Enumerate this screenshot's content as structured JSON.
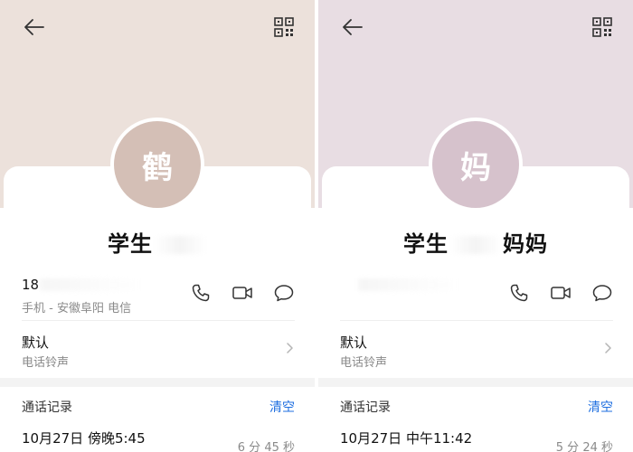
{
  "panels": [
    {
      "hero_color": "#ece1db",
      "avatar_color": "#d4bfb6",
      "avatar_char": "鹤",
      "name_prefix": "学生",
      "name_suffix": "",
      "number": "18",
      "location": "手机 - 安徽阜阳 电信",
      "ringtone_title": "默认",
      "ringtone_sub": "电话铃声",
      "log_title": "通话记录",
      "clear_label": "清空",
      "call_time": "10月27日 傍晚5:45",
      "call_duration": "6 分 45 秒"
    },
    {
      "hero_color": "#e8dde3",
      "avatar_color": "#d6c2cc",
      "avatar_char": "妈",
      "name_prefix": "学生",
      "name_suffix": "妈妈",
      "number": "",
      "location": "",
      "ringtone_title": "默认",
      "ringtone_sub": "电话铃声",
      "log_title": "通话记录",
      "clear_label": "清空",
      "call_time": "10月27日 中午11:42",
      "call_duration": "5 分 24 秒"
    }
  ],
  "icons": {
    "back": "back-arrow-icon",
    "qr": "qr-code-icon",
    "call": "phone-icon",
    "video": "video-call-icon",
    "message": "message-icon",
    "chevron": "chevron-right-icon"
  },
  "colors": {
    "accent": "#1f6fe0",
    "secondary_text": "#8a8a8a"
  }
}
